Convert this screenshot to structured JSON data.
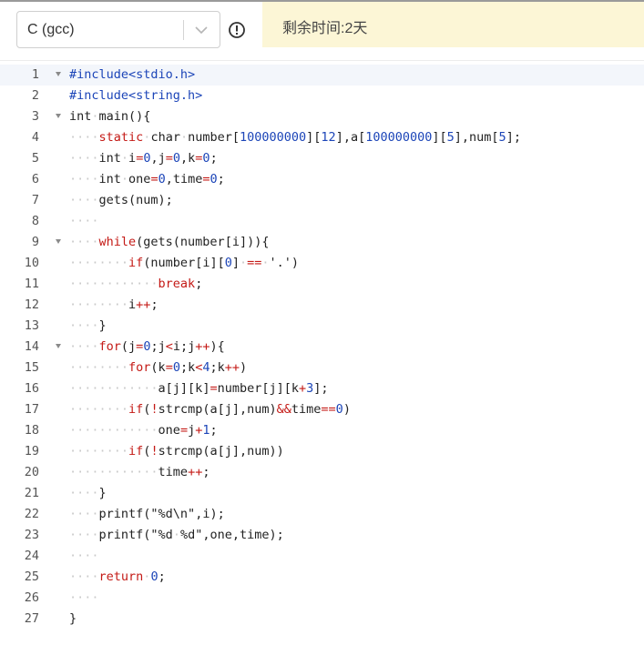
{
  "toolbar": {
    "language_selected": "C (gcc)",
    "notice_text": "剩余时间:2天"
  },
  "colors": {
    "keyword": "#c41a16",
    "preprocessor": "#1c45b8",
    "number": "#1c45b8",
    "notice_bg": "#fcf6d6",
    "whitespace_marker": "#c9c9c9"
  },
  "icons": {
    "language_dropdown": "chevron-down-icon",
    "info": "info-icon",
    "fold": "fold-arrow-icon"
  },
  "editor": {
    "active_line": 1,
    "lines": [
      {
        "n": "1",
        "fold": true,
        "tokens": [
          [
            "pp",
            "#include<stdio.h>"
          ]
        ]
      },
      {
        "n": "2",
        "fold": false,
        "tokens": [
          [
            "pp",
            "#include<string.h>"
          ]
        ]
      },
      {
        "n": "3",
        "fold": true,
        "tokens": [
          [
            "type",
            "int"
          ],
          [
            "ws",
            "·"
          ],
          [
            "fn",
            "main(){"
          ]
        ]
      },
      {
        "n": "4",
        "fold": false,
        "tokens": [
          [
            "ws",
            "····"
          ],
          [
            "kw",
            "static"
          ],
          [
            "ws",
            "·"
          ],
          [
            "type",
            "char"
          ],
          [
            "ws",
            "·"
          ],
          [
            "t",
            "number["
          ],
          [
            "num",
            "100000000"
          ],
          [
            "t",
            "]["
          ],
          [
            "num",
            "12"
          ],
          [
            "t",
            "],a["
          ],
          [
            "num",
            "100000000"
          ],
          [
            "t",
            "]["
          ],
          [
            "num",
            "5"
          ],
          [
            "t",
            "],num["
          ],
          [
            "num",
            "5"
          ],
          [
            "t",
            "];"
          ]
        ]
      },
      {
        "n": "5",
        "fold": false,
        "tokens": [
          [
            "ws",
            "····"
          ],
          [
            "type",
            "int"
          ],
          [
            "ws",
            "·"
          ],
          [
            "t",
            "i"
          ],
          [
            "op",
            "="
          ],
          [
            "num",
            "0"
          ],
          [
            "t",
            ",j"
          ],
          [
            "op",
            "="
          ],
          [
            "num",
            "0"
          ],
          [
            "t",
            ",k"
          ],
          [
            "op",
            "="
          ],
          [
            "num",
            "0"
          ],
          [
            "t",
            ";"
          ]
        ]
      },
      {
        "n": "6",
        "fold": false,
        "tokens": [
          [
            "ws",
            "····"
          ],
          [
            "type",
            "int"
          ],
          [
            "ws",
            "·"
          ],
          [
            "t",
            "one"
          ],
          [
            "op",
            "="
          ],
          [
            "num",
            "0"
          ],
          [
            "t",
            ",time"
          ],
          [
            "op",
            "="
          ],
          [
            "num",
            "0"
          ],
          [
            "t",
            ";"
          ]
        ]
      },
      {
        "n": "7",
        "fold": false,
        "tokens": [
          [
            "ws",
            "····"
          ],
          [
            "t",
            "gets(num);"
          ]
        ]
      },
      {
        "n": "8",
        "fold": false,
        "tokens": [
          [
            "ws",
            "····"
          ]
        ]
      },
      {
        "n": "9",
        "fold": true,
        "tokens": [
          [
            "ws",
            "····"
          ],
          [
            "kw",
            "while"
          ],
          [
            "t",
            "(gets(number[i])){"
          ]
        ]
      },
      {
        "n": "10",
        "fold": false,
        "tokens": [
          [
            "ws",
            "········"
          ],
          [
            "kw",
            "if"
          ],
          [
            "t",
            "(number[i]["
          ],
          [
            "num",
            "0"
          ],
          [
            "t",
            "]"
          ],
          [
            "ws",
            "·"
          ],
          [
            "op",
            "=="
          ],
          [
            "ws",
            "·"
          ],
          [
            "str",
            "'.')"
          ]
        ]
      },
      {
        "n": "11",
        "fold": false,
        "tokens": [
          [
            "ws",
            "············"
          ],
          [
            "kw",
            "break"
          ],
          [
            "t",
            ";"
          ]
        ]
      },
      {
        "n": "12",
        "fold": false,
        "tokens": [
          [
            "ws",
            "········"
          ],
          [
            "t",
            "i"
          ],
          [
            "op",
            "++"
          ],
          [
            "t",
            ";"
          ]
        ]
      },
      {
        "n": "13",
        "fold": false,
        "tokens": [
          [
            "ws",
            "····"
          ],
          [
            "t",
            "}"
          ]
        ]
      },
      {
        "n": "14",
        "fold": true,
        "tokens": [
          [
            "ws",
            "····"
          ],
          [
            "kw",
            "for"
          ],
          [
            "t",
            "(j"
          ],
          [
            "op",
            "="
          ],
          [
            "num",
            "0"
          ],
          [
            "t",
            ";j"
          ],
          [
            "op",
            "<"
          ],
          [
            "t",
            "i;j"
          ],
          [
            "op",
            "++"
          ],
          [
            "t",
            "){"
          ]
        ]
      },
      {
        "n": "15",
        "fold": false,
        "tokens": [
          [
            "ws",
            "········"
          ],
          [
            "kw",
            "for"
          ],
          [
            "t",
            "(k"
          ],
          [
            "op",
            "="
          ],
          [
            "num",
            "0"
          ],
          [
            "t",
            ";k"
          ],
          [
            "op",
            "<"
          ],
          [
            "num",
            "4"
          ],
          [
            "t",
            ";k"
          ],
          [
            "op",
            "++"
          ],
          [
            "t",
            ")"
          ]
        ]
      },
      {
        "n": "16",
        "fold": false,
        "tokens": [
          [
            "ws",
            "············"
          ],
          [
            "t",
            "a[j][k]"
          ],
          [
            "op",
            "="
          ],
          [
            "t",
            "number[j][k"
          ],
          [
            "op",
            "+"
          ],
          [
            "num",
            "3"
          ],
          [
            "t",
            "];"
          ]
        ]
      },
      {
        "n": "17",
        "fold": false,
        "tokens": [
          [
            "ws",
            "········"
          ],
          [
            "kw",
            "if"
          ],
          [
            "t",
            "("
          ],
          [
            "op",
            "!"
          ],
          [
            "t",
            "strcmp(a[j],num)"
          ],
          [
            "op",
            "&&"
          ],
          [
            "t",
            "time"
          ],
          [
            "op",
            "=="
          ],
          [
            "num",
            "0"
          ],
          [
            "t",
            ")"
          ]
        ]
      },
      {
        "n": "18",
        "fold": false,
        "tokens": [
          [
            "ws",
            "············"
          ],
          [
            "t",
            "one"
          ],
          [
            "op",
            "="
          ],
          [
            "t",
            "j"
          ],
          [
            "op",
            "+"
          ],
          [
            "num",
            "1"
          ],
          [
            "t",
            ";"
          ]
        ]
      },
      {
        "n": "19",
        "fold": false,
        "tokens": [
          [
            "ws",
            "········"
          ],
          [
            "kw",
            "if"
          ],
          [
            "t",
            "("
          ],
          [
            "op",
            "!"
          ],
          [
            "t",
            "strcmp(a[j],num))"
          ]
        ]
      },
      {
        "n": "20",
        "fold": false,
        "tokens": [
          [
            "ws",
            "············"
          ],
          [
            "t",
            "time"
          ],
          [
            "op",
            "++"
          ],
          [
            "t",
            ";"
          ]
        ]
      },
      {
        "n": "21",
        "fold": false,
        "tokens": [
          [
            "ws",
            "····"
          ],
          [
            "t",
            "}"
          ]
        ]
      },
      {
        "n": "22",
        "fold": false,
        "tokens": [
          [
            "ws",
            "····"
          ],
          [
            "t",
            "printf("
          ],
          [
            "str",
            "\"%d\\n\""
          ],
          [
            "t",
            ",i);"
          ]
        ]
      },
      {
        "n": "23",
        "fold": false,
        "tokens": [
          [
            "ws",
            "····"
          ],
          [
            "t",
            "printf("
          ],
          [
            "str",
            "\"%d"
          ],
          [
            "ws",
            "·"
          ],
          [
            "str",
            "%d\""
          ],
          [
            "t",
            ",one,time);"
          ]
        ]
      },
      {
        "n": "24",
        "fold": false,
        "tokens": [
          [
            "ws",
            "····"
          ]
        ]
      },
      {
        "n": "25",
        "fold": false,
        "tokens": [
          [
            "ws",
            "····"
          ],
          [
            "kw",
            "return"
          ],
          [
            "ws",
            "·"
          ],
          [
            "num",
            "0"
          ],
          [
            "t",
            ";"
          ]
        ]
      },
      {
        "n": "26",
        "fold": false,
        "tokens": [
          [
            "ws",
            "····"
          ]
        ]
      },
      {
        "n": "27",
        "fold": false,
        "tokens": [
          [
            "t",
            "}"
          ]
        ]
      }
    ]
  }
}
